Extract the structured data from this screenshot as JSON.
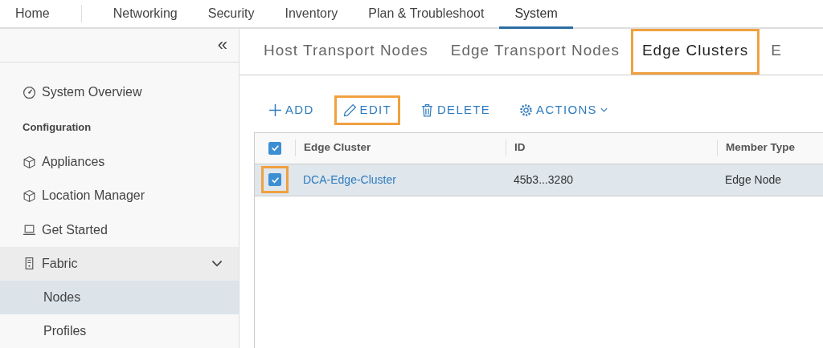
{
  "top_nav": [
    {
      "label": "Home",
      "selected": false
    },
    {
      "label": "Networking",
      "selected": false
    },
    {
      "label": "Security",
      "selected": false
    },
    {
      "label": "Inventory",
      "selected": false
    },
    {
      "label": "Plan & Troubleshoot",
      "selected": false
    },
    {
      "label": "System",
      "selected": true
    }
  ],
  "sidebar": {
    "collapse_glyph": "«",
    "items": [
      {
        "kind": "item",
        "label": "System Overview",
        "selected": false
      },
      {
        "kind": "heading",
        "label": "Configuration"
      },
      {
        "kind": "item",
        "label": "Appliances",
        "selected": false
      },
      {
        "kind": "item",
        "label": "Location Manager",
        "selected": false
      },
      {
        "kind": "item",
        "label": "Get Started",
        "selected": false
      },
      {
        "kind": "group",
        "label": "Fabric",
        "expanded": true,
        "children": [
          {
            "label": "Nodes",
            "selected": true
          },
          {
            "label": "Profiles",
            "selected": false
          }
        ]
      }
    ]
  },
  "tabs": [
    {
      "label": "Host Transport Nodes",
      "selected": false,
      "highlighted": false
    },
    {
      "label": "Edge Transport Nodes",
      "selected": false,
      "highlighted": false
    },
    {
      "label": "Edge Clusters",
      "selected": true,
      "highlighted": true
    },
    {
      "label": "E",
      "selected": false,
      "highlighted": false
    }
  ],
  "toolbar": [
    {
      "kind": "add",
      "label": "ADD",
      "highlighted": false
    },
    {
      "kind": "edit",
      "label": "EDIT",
      "highlighted": true
    },
    {
      "kind": "delete",
      "label": "DELETE",
      "highlighted": false
    },
    {
      "kind": "actions",
      "label": "ACTIONS",
      "highlighted": false
    }
  ],
  "table": {
    "all_checked": true,
    "columns": [
      "Edge Cluster",
      "ID",
      "Member Type"
    ],
    "rows": [
      {
        "selected": true,
        "checkbox_highlighted": true,
        "cells": [
          "DCA-Edge-Cluster",
          "45b3...3280",
          "Edge Node"
        ]
      }
    ]
  }
}
